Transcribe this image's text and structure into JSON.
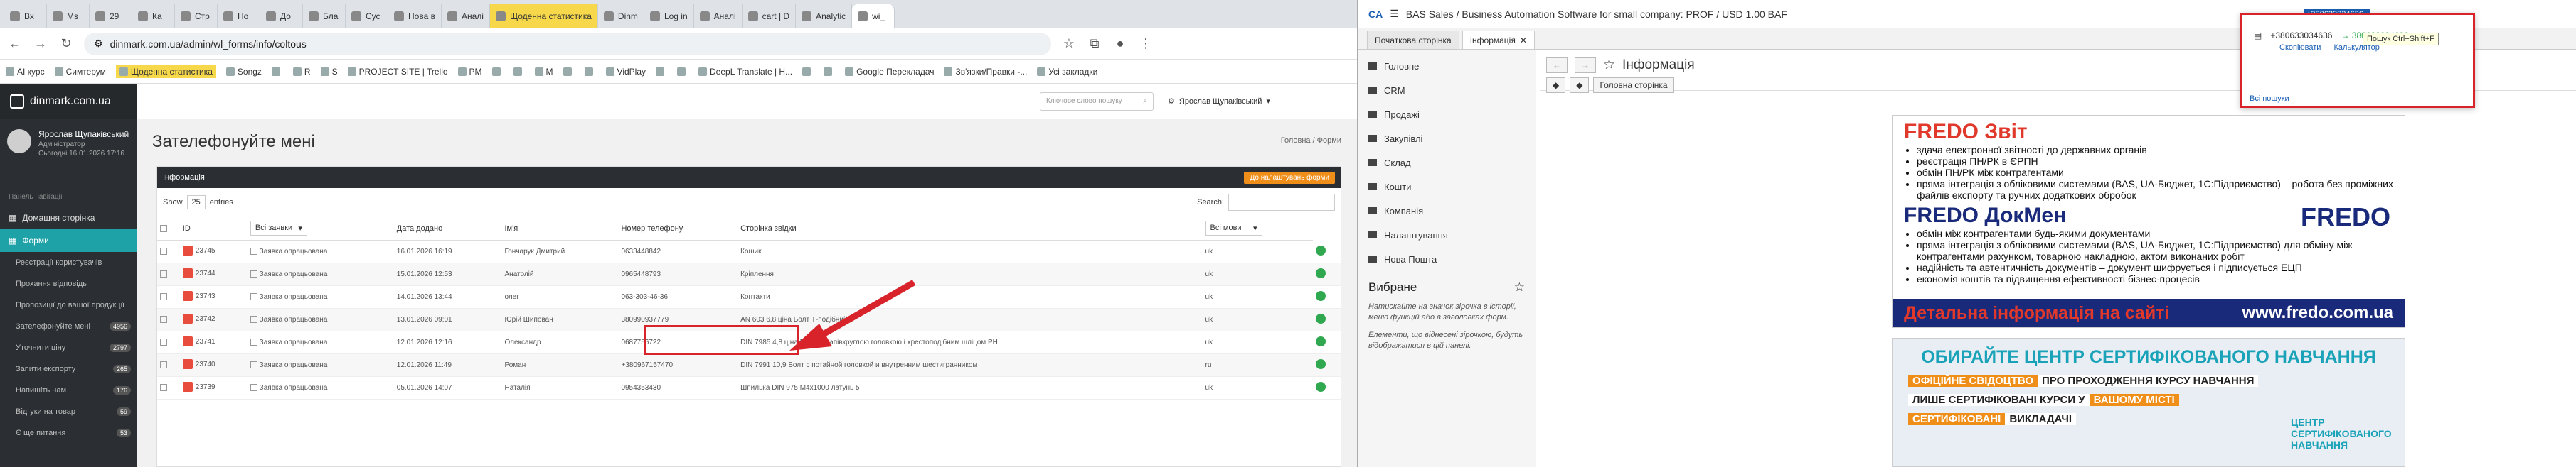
{
  "browser": {
    "tabs": [
      {
        "label": "Вх"
      },
      {
        "label": "Ms"
      },
      {
        "label": "29"
      },
      {
        "label": "Ка"
      },
      {
        "label": "Стр"
      },
      {
        "label": "Но"
      },
      {
        "label": "До"
      },
      {
        "label": "Бла"
      },
      {
        "label": "Сус"
      },
      {
        "label": "Нова в"
      },
      {
        "label": "Аналі"
      },
      {
        "label": "Щоденна статистика"
      },
      {
        "label": "Dinm"
      },
      {
        "label": "Log in"
      },
      {
        "label": "Аналі"
      },
      {
        "label": "cart | D"
      },
      {
        "label": "Analytic"
      },
      {
        "label": "wi_"
      }
    ],
    "active_tab": 17,
    "highlight_tab": 11,
    "url": "dinmark.com.ua/admin/wl_forms/info/coltous",
    "bookmarks": [
      "AI курс",
      "Симтерум",
      "Щоденна статистика",
      "Songz",
      "",
      "R",
      "S",
      "PROJECT SITE | Trello",
      "PM",
      "",
      "",
      "M",
      "",
      "",
      "VidPlay",
      "",
      "",
      "DeepL Translate | H...",
      "",
      "",
      "Google Перекладач",
      "Зв'язки/Правки -...",
      "Усі закладки"
    ]
  },
  "admin": {
    "logo": "dinmark.com.ua",
    "user_name": "Ярослав Щупаківський",
    "user_role": "Адміністратор",
    "user_date": "Сьогодні 16.01.2026 17:16",
    "sidebar_section": "Панель навігації",
    "sidebar_items": [
      {
        "label": "Домашня сторінка"
      },
      {
        "label": "Форми",
        "active": true
      }
    ],
    "sidebar_sub": [
      {
        "label": "Реєстрації користувачів",
        "badge": ""
      },
      {
        "label": "Прохання відповідь",
        "badge": ""
      },
      {
        "label": "Пропозиції до вашої продукції",
        "badge": ""
      },
      {
        "label": "Зателефонуйте мені",
        "badge": "4956"
      },
      {
        "label": "Уточнити ціну",
        "badge": "2797"
      },
      {
        "label": "Запити експорту",
        "badge": "265"
      },
      {
        "label": "Напишіть нам",
        "badge": "176"
      },
      {
        "label": "Відгуки на товар",
        "badge": "59"
      },
      {
        "label": "Є ще питання",
        "badge": "53"
      }
    ],
    "search_placeholder": "Ключове слово пошуку",
    "top_user": "Ярослав Щупаківський",
    "page_title": "Зателефонуйте мені",
    "breadcrumb": "Головна / Форми",
    "panel_title": "Інформація",
    "panel_button": "До налаштувань форми",
    "show_label": "Show",
    "show_value": "25",
    "entries_label": "entries",
    "search_label": "Search:",
    "columns": [
      "ID",
      "Всі заявки",
      "Дата додано",
      "Ім'я",
      "Номер телефону",
      "Сторінка звідки",
      "Всі мови"
    ],
    "rows": [
      {
        "id": "23745",
        "status": "Заявка опрацьована",
        "date": "16.01.2026 16:19",
        "name": "Гончарук Дмитрий",
        "phone": "0633448842",
        "page": "Кошик",
        "lang": "uk"
      },
      {
        "id": "23744",
        "status": "Заявка опрацьована",
        "date": "15.01.2026 12:53",
        "name": "Анатолій",
        "phone": "0965448793",
        "page": "Кріплення",
        "lang": "uk"
      },
      {
        "id": "23743",
        "status": "Заявка опрацьована",
        "date": "14.01.2026 13:44",
        "name": "олег",
        "phone": "063-303-46-36",
        "page": "Контакти",
        "lang": "uk"
      },
      {
        "id": "23742",
        "status": "Заявка опрацьована",
        "date": "13.01.2026 09:01",
        "name": "Юрій Шипован",
        "phone": "380990937779",
        "page": "AN 603 6,8 ціна Болт Т-подібний",
        "lang": "uk"
      },
      {
        "id": "23741",
        "status": "Заявка опрацьована",
        "date": "12.01.2026 12:16",
        "name": "Олександр",
        "phone": "0687756722",
        "page": "DIN 7985 4,8 ціна Гвинт з напівкруглою головкою і хрестоподібним шліцом PH",
        "lang": "uk"
      },
      {
        "id": "23740",
        "status": "Заявка опрацьована",
        "date": "12.01.2026 11:49",
        "name": "Роман",
        "phone": "+380967157470",
        "page": "DIN 7991 10,9 Болт с потайной головкой и внутренним шестигранником",
        "lang": "ru"
      },
      {
        "id": "23739",
        "status": "Заявка опрацьована",
        "date": "05.01.2026 14:07",
        "name": "Наталія",
        "phone": "0954353430",
        "page": "Шпилька DIN 975 М4х1000 латунь 5",
        "lang": "uk"
      }
    ]
  },
  "app": {
    "title": "BAS Sales / Business Automation Software for small company: PROF / USD 1.00 BAF",
    "logo": "CA",
    "tabs": [
      {
        "label": "Початкова сторінка"
      },
      {
        "label": "Інформація"
      }
    ],
    "nav": [
      "Головне",
      "CRM",
      "Продажі",
      "Закупівлі",
      "Склад",
      "Кошти",
      "Компанія",
      "Налаштування",
      "Нова Пошта"
    ],
    "favorites_title": "Вибране",
    "favorites_text1": "Натискайте на значок зірочка в історії, меню функцій або в заголовках форм.",
    "favorites_text2": "Елементи, що віднесені зірочкою, будуть відображатися в цій панелі.",
    "info_title": "Інформація",
    "home_button": "Головна сторінка",
    "search_selected": "+380633034636",
    "popup": {
      "phone": "+380633034636",
      "phone_alt": "→ 380633034636",
      "copy": "Скопіювати",
      "calc": "Калькулятор",
      "search_all": "Всі пошуки"
    },
    "tooltip": "Пошук Ctrl+Shift+F"
  },
  "fredo": {
    "heading1": "FREDO Звіт",
    "list1": [
      "здача електронної звітності до державних органів",
      "реєстрація ПН/РК в ЄРПН",
      "обмін ПН/РК між контрагентами",
      "пряма інтеграція з обліковими системами (BAS, UA-Бюджет, 1С:Підприємство) – робота без проміжних файлів експорту та ручних додаткових обробок"
    ],
    "logo": "FREDO",
    "heading2": "FREDO ДокМен",
    "list2": [
      "обмін між контрагентами будь-якими документами",
      "пряма інтеграція з обліковими системами (BAS, UA-Бюджет, 1С:Підприємство) для обміну між контрагентами рахунком, товарною накладною, актом виконаних робіт",
      "надійність та автентичність документів – документ шифрується і підписується ЕЦП",
      "економія коштів та підвищення ефективності бізнес-процесів"
    ],
    "footer_a": "Детальна інформація на сайті",
    "footer_b": "www.fredo.com.ua"
  },
  "cert": {
    "title": "ОБИРАЙТЕ ЦЕНТР СЕРТИФІКОВАНОГО НАВЧАННЯ",
    "line1a": "ОФІЦІЙНЕ СВІДОЦТВО",
    "line1b": "ПРО ПРОХОДЖЕННЯ КУРСУ НАВЧАННЯ",
    "line2a": "ЛИШЕ СЕРТИФІКОВАНІ КУРСИ У",
    "line2b": "ВАШОМУ МІСТІ",
    "line3a": "СЕРТИФІКОВАНІ",
    "line3b": "ВИКЛАДАЧІ",
    "logo": "ЦЕНТР СЕРТИФІКОВАНОГО НАВЧАННЯ"
  },
  "colors": {
    "accent": "#1ea2a8",
    "sidebar": "#2b2f33",
    "highlight_box": "#d8232a",
    "fredo_red": "#e0382b",
    "fredo_blue": "#1a2a7a",
    "status_green": "#2fa84f"
  }
}
